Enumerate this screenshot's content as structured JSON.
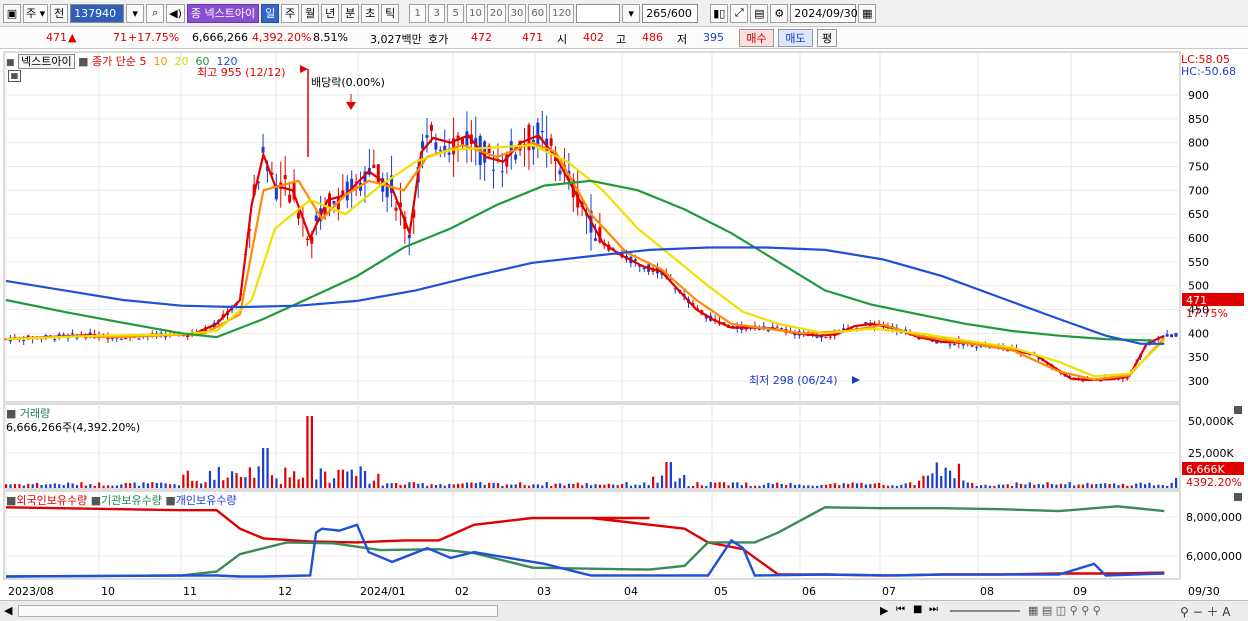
{
  "toolbar": {
    "period_label": "주",
    "prev_label": "전",
    "code": "137940",
    "stock_name": "넥스트아이",
    "stock_tag": "종",
    "period_tabs": [
      "일",
      "주",
      "월",
      "년",
      "분",
      "초",
      "틱"
    ],
    "active_tab": "일",
    "interval_buttons": [
      "1",
      "3",
      "5",
      "10",
      "20",
      "30",
      "60",
      "120"
    ],
    "count_value": "265",
    "count_total": "/600",
    "date": "2024/09/30"
  },
  "info": {
    "price": "471",
    "change": "71",
    "change_pct": "+17.75%",
    "volume": "6,666,266",
    "volume_pct": "4,392.20%",
    "turnover_pct": "8.51%",
    "amount": "3,027백만",
    "quote_label": "호가",
    "ask": "472",
    "bid": "471",
    "open_label": "시",
    "open": "402",
    "high_label": "고",
    "high": "486",
    "low_label": "저",
    "low": "395",
    "buy_label": "매수",
    "sell_label": "매도",
    "avg_label": "평"
  },
  "price_panel": {
    "legend_name": "넥스트아이",
    "legend_ma_label": "종가 단순",
    "ma_periods": [
      "5",
      "10",
      "20",
      "60",
      "120"
    ],
    "ma_colors": [
      "#e00000",
      "#ff8c00",
      "#f0e000",
      "#1f9a3a",
      "#2050d8"
    ],
    "high_annotation": "최고 955 (12/12)",
    "low_annotation": "최저 298 (06/24)",
    "dividend_annotation": "배당락(0.00%)",
    "lc_label": "LC:58.05",
    "hc_label": "HC:-50.68",
    "current_price_tag": "471",
    "current_change_tag": "17.75%",
    "y_ticks": [
      "900",
      "850",
      "800",
      "750",
      "700",
      "650",
      "600",
      "550",
      "500",
      "450",
      "400",
      "350",
      "300"
    ]
  },
  "volume_panel": {
    "title": "거래량",
    "value_label": "6,666,266주(4,392.20%)",
    "y_ticks": [
      "50,000K",
      "25,000K"
    ],
    "current_tag": "6,666K",
    "pct_tag": "4392.20%"
  },
  "holding_panel": {
    "legend": [
      "외국인보유수량",
      "기관보유수량",
      "개인보유수량"
    ],
    "y_ticks": [
      "8,000,000",
      "6,000,000"
    ]
  },
  "x_axis": {
    "labels": [
      "2023/08",
      "10",
      "11",
      "12",
      "2024/01",
      "02",
      "03",
      "04",
      "05",
      "06",
      "07",
      "08",
      "09"
    ],
    "end_label": "09/30"
  },
  "chart_data": {
    "type": "line",
    "title": "",
    "x_range": [
      "2023/08",
      "2024/09/30"
    ],
    "y_range": [
      280,
      960
    ],
    "series": [
      {
        "name": "5",
        "color": "#e00000",
        "values": [
          [
            0.0,
            388
          ],
          [
            0.035,
            392
          ],
          [
            0.07,
            396
          ],
          [
            0.1,
            392
          ],
          [
            0.13,
            396
          ],
          [
            0.16,
            398
          ],
          [
            0.18,
            420
          ],
          [
            0.2,
            470
          ],
          [
            0.21,
            670
          ],
          [
            0.22,
            775
          ],
          [
            0.23,
            710
          ],
          [
            0.245,
            700
          ],
          [
            0.26,
            600
          ],
          [
            0.275,
            680
          ],
          [
            0.29,
            690
          ],
          [
            0.31,
            740
          ],
          [
            0.33,
            705
          ],
          [
            0.345,
            610
          ],
          [
            0.355,
            780
          ],
          [
            0.365,
            810
          ],
          [
            0.38,
            800
          ],
          [
            0.395,
            815
          ],
          [
            0.41,
            770
          ],
          [
            0.425,
            760
          ],
          [
            0.44,
            800
          ],
          [
            0.455,
            815
          ],
          [
            0.47,
            770
          ],
          [
            0.49,
            680
          ],
          [
            0.51,
            590
          ],
          [
            0.525,
            565
          ],
          [
            0.545,
            540
          ],
          [
            0.56,
            530
          ],
          [
            0.575,
            490
          ],
          [
            0.59,
            450
          ],
          [
            0.605,
            428
          ],
          [
            0.62,
            412
          ],
          [
            0.64,
            412
          ],
          [
            0.655,
            410
          ],
          [
            0.675,
            400
          ],
          [
            0.695,
            395
          ],
          [
            0.71,
            398
          ],
          [
            0.725,
            415
          ],
          [
            0.74,
            420
          ],
          [
            0.76,
            410
          ],
          [
            0.78,
            392
          ],
          [
            0.8,
            382
          ],
          [
            0.82,
            380
          ],
          [
            0.84,
            373
          ],
          [
            0.86,
            365
          ],
          [
            0.88,
            355
          ],
          [
            0.895,
            330
          ],
          [
            0.91,
            305
          ],
          [
            0.925,
            302
          ],
          [
            0.945,
            304
          ],
          [
            0.96,
            310
          ],
          [
            0.975,
            378
          ],
          [
            0.99,
            395
          ]
        ]
      },
      {
        "name": "10",
        "color": "#ff8c00",
        "values": [
          [
            0.0,
            388
          ],
          [
            0.06,
            394
          ],
          [
            0.1,
            392
          ],
          [
            0.14,
            396
          ],
          [
            0.17,
            400
          ],
          [
            0.2,
            440
          ],
          [
            0.22,
            700
          ],
          [
            0.25,
            720
          ],
          [
            0.27,
            640
          ],
          [
            0.29,
            690
          ],
          [
            0.31,
            720
          ],
          [
            0.34,
            700
          ],
          [
            0.36,
            770
          ],
          [
            0.39,
            795
          ],
          [
            0.42,
            770
          ],
          [
            0.45,
            800
          ],
          [
            0.47,
            780
          ],
          [
            0.5,
            650
          ],
          [
            0.53,
            570
          ],
          [
            0.56,
            535
          ],
          [
            0.59,
            470
          ],
          [
            0.62,
            420
          ],
          [
            0.65,
            410
          ],
          [
            0.68,
            400
          ],
          [
            0.72,
            405
          ],
          [
            0.75,
            418
          ],
          [
            0.78,
            395
          ],
          [
            0.82,
            380
          ],
          [
            0.86,
            365
          ],
          [
            0.9,
            320
          ],
          [
            0.93,
            303
          ],
          [
            0.96,
            312
          ],
          [
            0.99,
            390
          ]
        ]
      },
      {
        "name": "20",
        "color": "#f0e000",
        "values": [
          [
            0.0,
            388
          ],
          [
            0.08,
            395
          ],
          [
            0.15,
            398
          ],
          [
            0.18,
            405
          ],
          [
            0.21,
            470
          ],
          [
            0.23,
            620
          ],
          [
            0.26,
            680
          ],
          [
            0.29,
            650
          ],
          [
            0.32,
            710
          ],
          [
            0.35,
            760
          ],
          [
            0.38,
            785
          ],
          [
            0.42,
            790
          ],
          [
            0.45,
            795
          ],
          [
            0.48,
            760
          ],
          [
            0.51,
            700
          ],
          [
            0.54,
            620
          ],
          [
            0.57,
            560
          ],
          [
            0.6,
            500
          ],
          [
            0.63,
            445
          ],
          [
            0.66,
            420
          ],
          [
            0.7,
            400
          ],
          [
            0.74,
            410
          ],
          [
            0.78,
            400
          ],
          [
            0.82,
            385
          ],
          [
            0.86,
            370
          ],
          [
            0.9,
            340
          ],
          [
            0.93,
            310
          ],
          [
            0.96,
            315
          ],
          [
            0.99,
            385
          ]
        ]
      },
      {
        "name": "60",
        "color": "#1f9a3a",
        "values": [
          [
            0.0,
            470
          ],
          [
            0.05,
            445
          ],
          [
            0.1,
            422
          ],
          [
            0.15,
            400
          ],
          [
            0.18,
            392
          ],
          [
            0.22,
            430
          ],
          [
            0.26,
            475
          ],
          [
            0.3,
            520
          ],
          [
            0.34,
            580
          ],
          [
            0.38,
            620
          ],
          [
            0.42,
            670
          ],
          [
            0.46,
            710
          ],
          [
            0.5,
            720
          ],
          [
            0.54,
            700
          ],
          [
            0.58,
            660
          ],
          [
            0.62,
            610
          ],
          [
            0.66,
            550
          ],
          [
            0.7,
            490
          ],
          [
            0.74,
            460
          ],
          [
            0.78,
            440
          ],
          [
            0.82,
            420
          ],
          [
            0.86,
            405
          ],
          [
            0.9,
            395
          ],
          [
            0.94,
            388
          ],
          [
            0.98,
            385
          ]
        ]
      },
      {
        "name": "120",
        "color": "#2050d8",
        "values": [
          [
            0.0,
            510
          ],
          [
            0.05,
            490
          ],
          [
            0.1,
            470
          ],
          [
            0.15,
            458
          ],
          [
            0.2,
            455
          ],
          [
            0.25,
            458
          ],
          [
            0.3,
            468
          ],
          [
            0.35,
            490
          ],
          [
            0.4,
            520
          ],
          [
            0.45,
            548
          ],
          [
            0.5,
            562
          ],
          [
            0.55,
            575
          ],
          [
            0.6,
            580
          ],
          [
            0.65,
            580
          ],
          [
            0.7,
            575
          ],
          [
            0.75,
            555
          ],
          [
            0.8,
            520
          ],
          [
            0.85,
            475
          ],
          [
            0.9,
            430
          ],
          [
            0.94,
            395
          ],
          [
            0.97,
            378
          ],
          [
            0.99,
            378
          ]
        ]
      }
    ]
  }
}
